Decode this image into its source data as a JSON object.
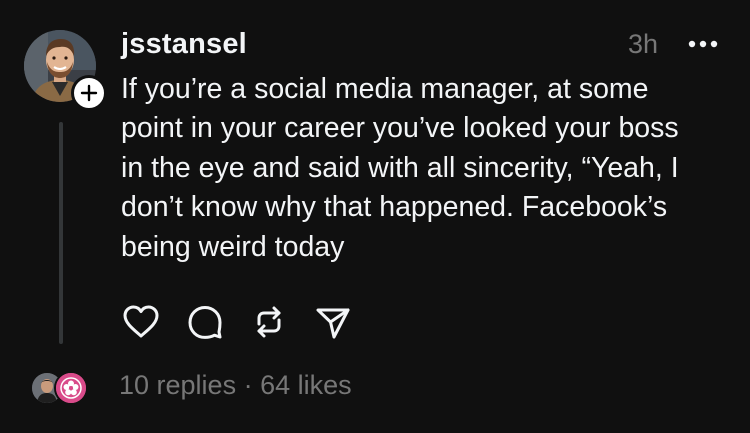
{
  "post": {
    "author": {
      "username": "jsstansel",
      "avatar": "profile-photo"
    },
    "time": "3h",
    "text": "If you’re a social media manager, at some\npoint in your career you’ve looked your boss\nin the eye and said with all sincerity, “Yeah, I\ndon’t know why that happened. Facebook’s\nbeing weird today",
    "actions": [
      "heart-icon",
      "comment-icon",
      "repost-icon",
      "share-icon"
    ],
    "footer": {
      "replies": "10 replies",
      "separator": "·",
      "likes": "64 likes"
    }
  },
  "colors": {
    "background": "#101010",
    "text_primary": "#f3f5f7",
    "text_secondary": "#777777",
    "thread_line": "#333638",
    "badge_pink": "#d94b8a"
  }
}
